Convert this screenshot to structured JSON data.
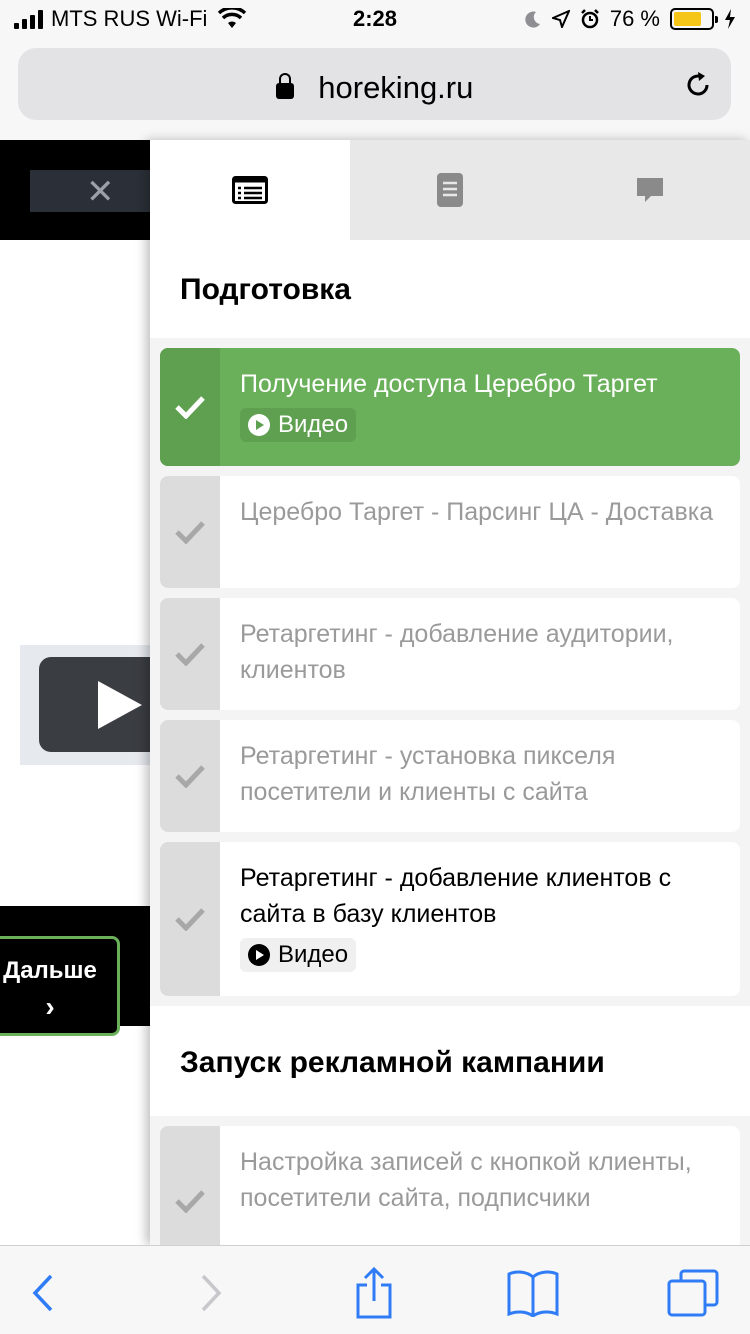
{
  "status_bar": {
    "carrier": "MTS RUS Wi-Fi",
    "time": "2:28",
    "battery_percent": "76 %",
    "battery_level": 0.76
  },
  "browser": {
    "url": "horeking.ru"
  },
  "background_page": {
    "next_label": "Дальше"
  },
  "panel": {
    "tabs": [
      {
        "icon": "lessons-list-icon",
        "active": true
      },
      {
        "icon": "document-icon",
        "active": false
      },
      {
        "icon": "comment-icon",
        "active": false
      }
    ],
    "sections": [
      {
        "title": "Подготовка",
        "lessons": [
          {
            "title": "Получение доступа Церебро Таргет",
            "badge": "Видео",
            "state": "done"
          },
          {
            "title": "Церебро Таргет - Парсинг ЦА - Доставка",
            "badge": "",
            "state": "locked"
          },
          {
            "title": "Ретаргетинг - добавление аудитории, клиентов",
            "badge": "",
            "state": "locked"
          },
          {
            "title": "Ретаргетинг - установка пикселя посетители и клиенты с сайта",
            "badge": "",
            "state": "locked"
          },
          {
            "title": "Ретаргетинг - добавление клиентов с сайта в базу клиентов",
            "badge": "Видео",
            "state": "available"
          }
        ]
      },
      {
        "title": "Запуск рекламной кампании",
        "lessons": [
          {
            "title": "Настройка записей с кнопкой клиенты, посетители сайта, подписчики",
            "badge": "",
            "state": "locked"
          }
        ]
      }
    ]
  },
  "colors": {
    "done_green": "#6ab05a",
    "ios_blue": "#2f7cf6"
  }
}
